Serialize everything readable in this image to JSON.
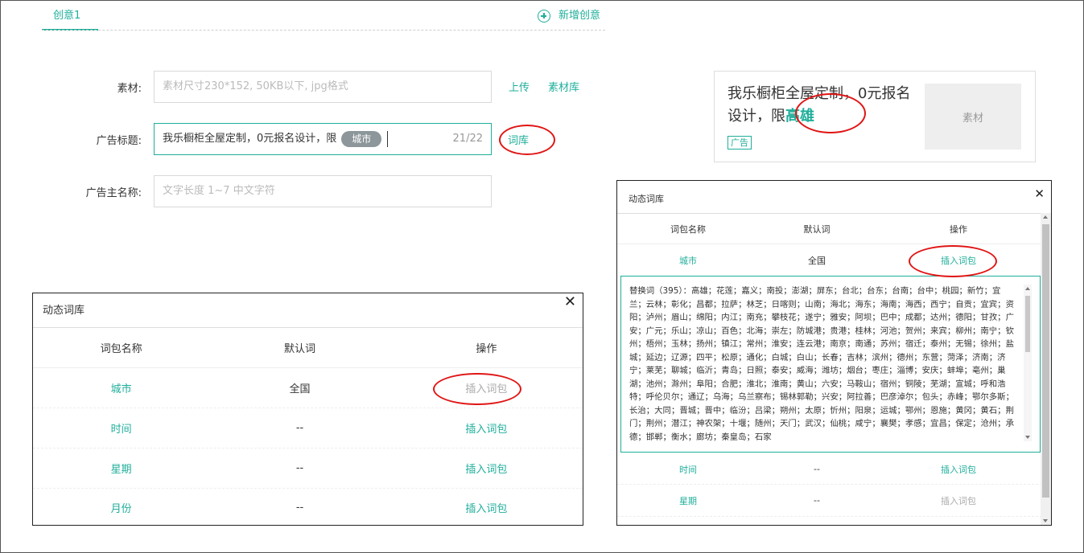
{
  "tabs": {
    "active": "创意1",
    "add_label": "新增创意"
  },
  "form": {
    "material_label": "素材:",
    "material_placeholder": "素材尺寸230*152, 50KB以下, jpg格式",
    "upload": "上传",
    "library": "素材库",
    "title_label": "广告标题:",
    "title_value": "我乐橱柜全屋定制，0元报名设计，限",
    "title_chip": "城市",
    "title_counter": "21/22",
    "word_lib": "词库",
    "advertiser_label": "广告主名称:",
    "advertiser_placeholder": "文字长度 1~7 中文字符"
  },
  "preview": {
    "text": "我乐橱柜全屋定制，0元报名设计，限",
    "highlight": "高雄",
    "tag": "广告",
    "thumb": "素材"
  },
  "dialog_left": {
    "title": "动态词库",
    "headers": [
      "词包名称",
      "默认词",
      "操作"
    ],
    "rows": [
      {
        "name": "城市",
        "default": "全国",
        "action": "插入词包"
      },
      {
        "name": "时间",
        "default": "--",
        "action": "插入词包"
      },
      {
        "name": "星期",
        "default": "--",
        "action": "插入词包"
      },
      {
        "name": "月份",
        "default": "--",
        "action": "插入词包"
      }
    ]
  },
  "dialog_right": {
    "title": "动态词库",
    "headers": [
      "词包名称",
      "默认词",
      "操作"
    ],
    "rows": [
      {
        "name": "城市",
        "default": "全国",
        "action": "插入词包"
      },
      {
        "name": "时间",
        "default": "--",
        "action": "插入词包"
      },
      {
        "name": "星期",
        "default": "--",
        "action": "插入词包"
      }
    ],
    "synonyms": "替换词（395）：高雄；花莲；嘉义；南投；澎湖；屏东；台北；台东；台南；台中；桃园；新竹；宜兰；云林；彰化；昌都；拉萨；林芝；日喀则；山南；海北；海东；海南；海西；西宁；自贡；宜宾；资阳；泸州；眉山；绵阳；内江；南充；攀枝花；遂宁；雅安；阿坝；巴中；成都；达州；德阳；甘孜；广安；广元；乐山；凉山；百色；北海；崇左；防城港；贵港；桂林；河池；贺州；来宾；柳州；南宁；钦州；梧州；玉林；扬州；镇江；常州；淮安；连云港；南京；南通；苏州；宿迁；泰州；无锡；徐州；盐城；延边；辽源；四平；松原；通化；白城；白山；长春；吉林；滨州；德州；东营；菏泽；济南；济宁；莱芜；聊城；临沂；青岛；日照；泰安；威海；潍坊；烟台；枣庄；淄博；安庆；蚌埠；亳州；巢湖；池州；滁州；阜阳；合肥；淮北；淮南；黄山；六安；马鞍山；宿州；铜陵；芜湖；宣城；呼和浩特；呼伦贝尔；通辽；乌海；乌兰察布；锡林郭勒；兴安；阿拉善；巴彦淖尔；包头；赤峰；鄂尔多斯；长治；大同；晋城；晋中；临汾；吕梁；朔州；太原；忻州；阳泉；运城；鄂州；恩施；黄冈；黄石；荆门；荆州；潜江；神农架；十堰；随州；天门；武汉；仙桃；咸宁；襄樊；孝感；宜昌；保定；沧州；承德；邯郸；衡水；廊坊；秦皇岛；石家"
  }
}
